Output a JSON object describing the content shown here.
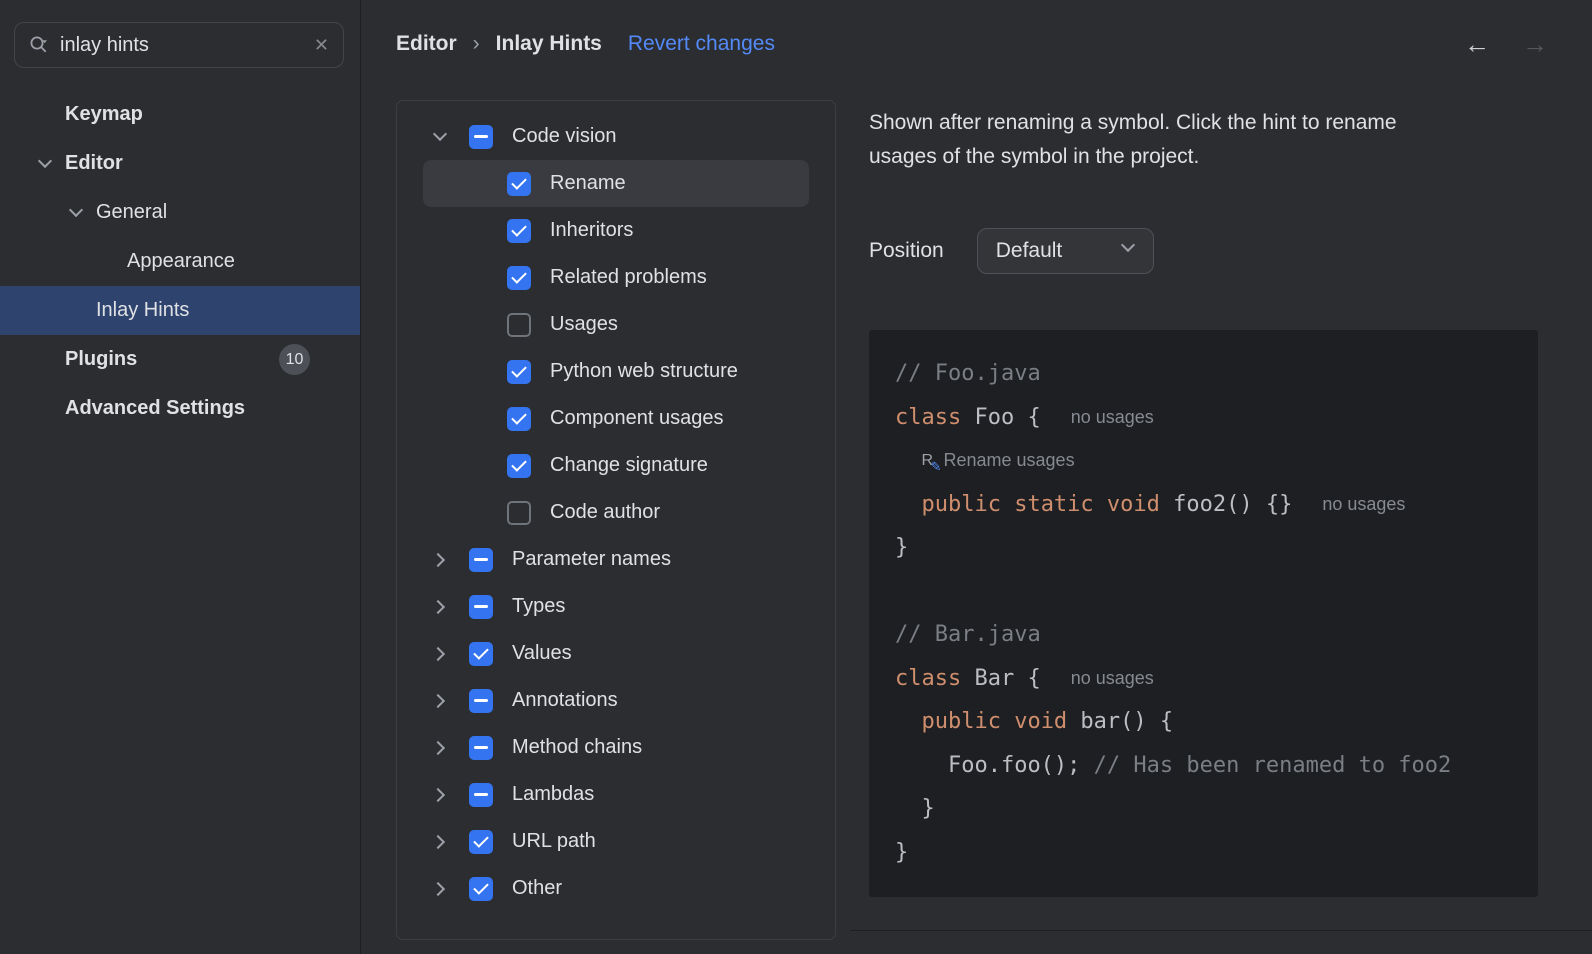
{
  "colors": {
    "accent_blue": "#3574F0",
    "link_blue": "#548AF7",
    "sidebar_selection": "#2E436E",
    "tree_selection": "#393B40",
    "code_background": "#1E1F22",
    "code_keyword": "#CF8E6D",
    "code_comment": "#7A7E85",
    "code_plain": "#BCBEC4",
    "inlay_hint_gray": "#868A91"
  },
  "sidebar": {
    "search": {
      "value": "inlay hints",
      "clear_icon": "✕"
    },
    "items": [
      {
        "label": "Keymap"
      },
      {
        "label": "Editor",
        "chevron": "down"
      },
      {
        "label": "General",
        "chevron": "down"
      },
      {
        "label": "Appearance"
      },
      {
        "label": "Inlay Hints",
        "selected": true
      },
      {
        "label": "Plugins",
        "badge": "10"
      },
      {
        "label": "Advanced Settings"
      }
    ]
  },
  "header": {
    "breadcrumb": [
      {
        "label": "Editor"
      },
      {
        "label": "Inlay Hints"
      }
    ],
    "separator": "›",
    "revert_label": "Revert changes",
    "back_icon": "←",
    "forward_icon": "→"
  },
  "tree": {
    "items": [
      {
        "label": "Code vision",
        "checkbox": "indeterminate",
        "chevron": "down",
        "expanded": true
      },
      {
        "label": "Rename",
        "checkbox": "checked",
        "selected": true
      },
      {
        "label": "Inheritors",
        "checkbox": "checked"
      },
      {
        "label": "Related problems",
        "checkbox": "checked"
      },
      {
        "label": "Usages",
        "checkbox": "unchecked"
      },
      {
        "label": "Python web structure",
        "checkbox": "checked"
      },
      {
        "label": "Component usages",
        "checkbox": "checked"
      },
      {
        "label": "Change signature",
        "checkbox": "checked"
      },
      {
        "label": "Code author",
        "checkbox": "unchecked"
      },
      {
        "label": "Parameter names",
        "checkbox": "indeterminate",
        "chevron": "right"
      },
      {
        "label": "Types",
        "checkbox": "indeterminate",
        "chevron": "right"
      },
      {
        "label": "Values",
        "checkbox": "checked",
        "chevron": "right"
      },
      {
        "label": "Annotations",
        "checkbox": "indeterminate",
        "chevron": "right"
      },
      {
        "label": "Method chains",
        "checkbox": "indeterminate",
        "chevron": "right"
      },
      {
        "label": "Lambdas",
        "checkbox": "indeterminate",
        "chevron": "right"
      },
      {
        "label": "URL path",
        "checkbox": "checked",
        "chevron": "right"
      },
      {
        "label": "Other",
        "checkbox": "checked",
        "chevron": "right"
      }
    ]
  },
  "details": {
    "description": "Shown after renaming a symbol. Click the hint to rename usages of the symbol in the project.",
    "position": {
      "label": "Position",
      "value": "Default"
    },
    "code": {
      "line1_comment": "// Foo.java",
      "line2_keyword": "class",
      "line2_code": " Foo {",
      "line2_hint": "no usages",
      "line3_icon": "R",
      "line3_pen": "✎",
      "line3_hint": "Rename usages",
      "line4_keyword": "public static void",
      "line4_code": " foo2() {}",
      "line4_hint": "no usages",
      "line5_code": "}",
      "line7_comment": "// Bar.java",
      "line8_keyword": "class",
      "line8_code": " Bar {",
      "line8_hint": "no usages",
      "line9_keyword": "public void",
      "line9_code": " bar() {",
      "line10_code": "Foo.foo(); ",
      "line10_comment": "// Has been renamed to foo2",
      "line11_code": "}",
      "line12_code": "}"
    }
  }
}
